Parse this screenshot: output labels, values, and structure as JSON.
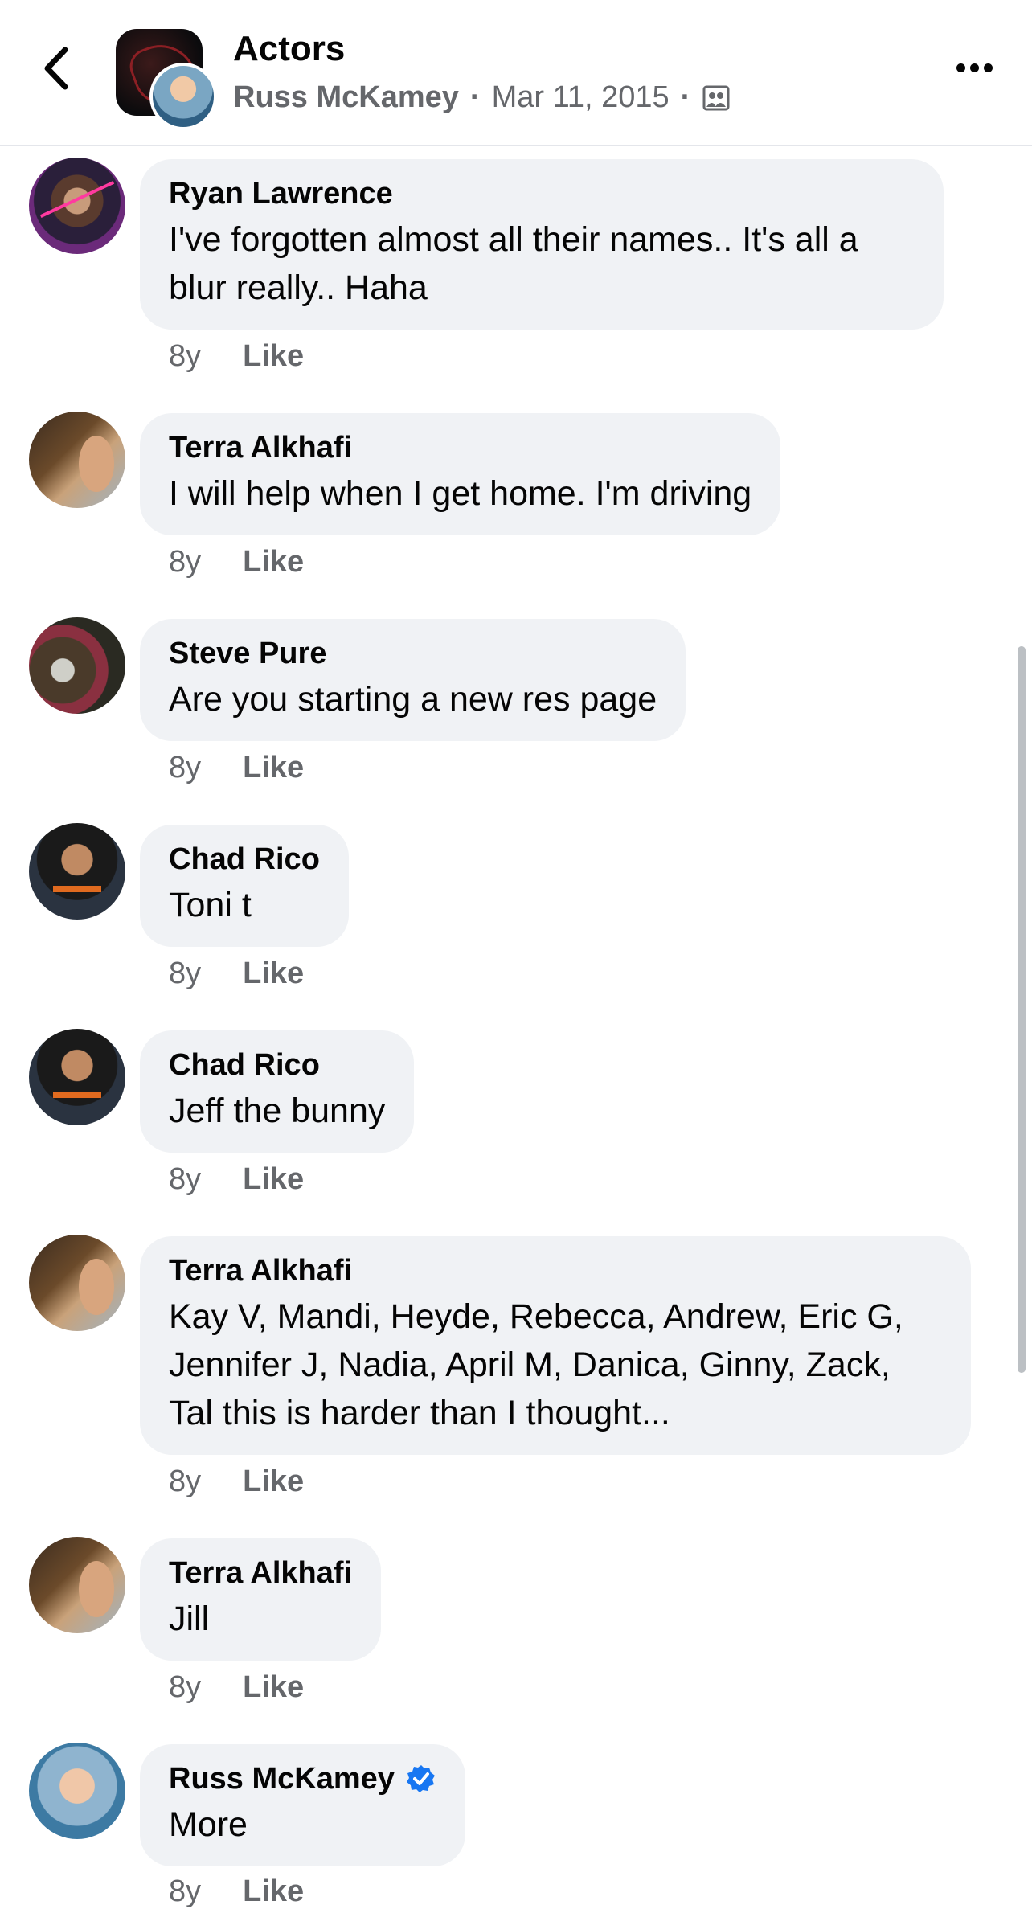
{
  "header": {
    "title": "Actors",
    "author": "Russ McKamey",
    "separator": "·",
    "date": "Mar 11, 2015",
    "audience_icon": "group-audience-icon"
  },
  "comments": [
    {
      "name": "Ryan Lawrence",
      "text": "I've forgotten almost all their names.. It's all a blur really.. Haha",
      "age": "8y",
      "like": "Like"
    },
    {
      "name": "Terra Alkhafi",
      "text": "I will help when I get home. I'm driving",
      "age": "8y",
      "like": "Like"
    },
    {
      "name": "Steve Pure",
      "text": "Are you starting a new res page",
      "age": "8y",
      "like": "Like"
    },
    {
      "name": "Chad Rico",
      "text": "Toni t",
      "age": "8y",
      "like": "Like"
    },
    {
      "name": "Chad Rico",
      "text": "Jeff the bunny",
      "age": "8y",
      "like": "Like"
    },
    {
      "name": "Terra Alkhafi",
      "text": "Kay V, Mandi, Heyde, Rebecca, Andrew, Eric G, Jennifer J, Nadia, April M, Danica, Ginny, Zack, Tal this is harder than I thought...",
      "age": "8y",
      "like": "Like"
    },
    {
      "name": "Terra Alkhafi",
      "text": "Jill",
      "age": "8y",
      "like": "Like"
    },
    {
      "name": "Russ McKamey",
      "text": "More",
      "age": "8y",
      "like": "Like",
      "verified": true
    }
  ],
  "colors": {
    "bubble": "#f0f2f5",
    "meta_text": "#65676b",
    "verified_badge": "#1877f2"
  }
}
